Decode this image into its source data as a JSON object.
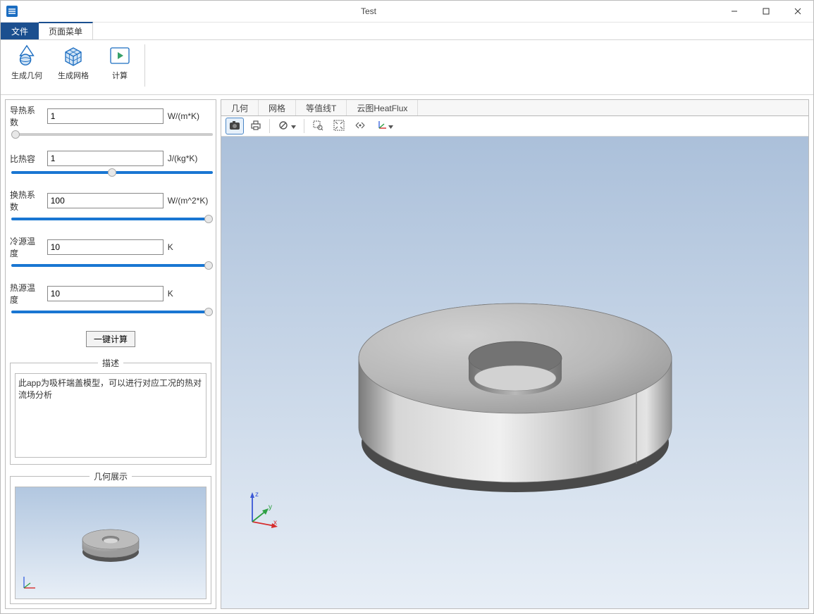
{
  "window": {
    "title": "Test"
  },
  "menubar": {
    "file": "文件",
    "pageMenu": "页面菜单"
  },
  "ribbon": {
    "genGeometry": "生成几何",
    "genMesh": "生成网格",
    "compute": "计算"
  },
  "params": {
    "thermalCond": {
      "label": "导热系数",
      "value": "1",
      "unit": "W/(m*K)",
      "slider": 0
    },
    "specHeat": {
      "label": "比热容",
      "value": "1",
      "unit": "J/(kg*K)",
      "slider": 50
    },
    "heatTransfer": {
      "label": "换热系数",
      "value": "100",
      "unit": "W/(m^2*K)",
      "slider": 100
    },
    "coldTemp": {
      "label": "冷源温度",
      "value": "10",
      "unit": "K",
      "slider": 100
    },
    "hotTemp": {
      "label": "热源温度",
      "value": "10",
      "unit": "K",
      "slider": 100
    },
    "calcBtn": "一键计算"
  },
  "panels": {
    "descriptionTitle": "描述",
    "descriptionText": "此app为吸杆端盖模型，可以进行对应工况的热对流场分析",
    "previewTitle": "几何展示"
  },
  "viewTabs": {
    "geometry": "几何",
    "mesh": "网格",
    "isolineT": "等值线T",
    "cloudHeatFlux": "云图HeatFlux"
  },
  "axes": {
    "x": "x",
    "y": "y",
    "z": "z"
  }
}
